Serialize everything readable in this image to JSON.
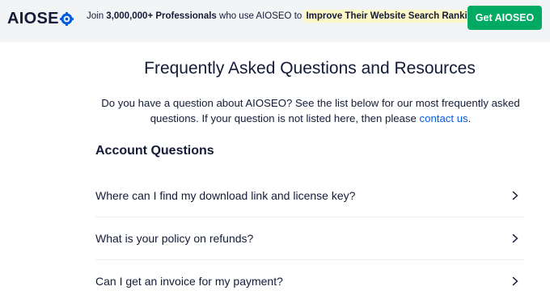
{
  "brand": {
    "logo_prefix": "AIOSE",
    "logo_suffix": "",
    "logo_full": "AIOSEO"
  },
  "promo": {
    "part1": "Join ",
    "count": "3,000,000+",
    "part2": " Professionals",
    "part3": " who use AIOSEO to ",
    "highlight": "Improve Their Website Search Rankings!"
  },
  "cta": {
    "label": "Get AIOSEO"
  },
  "faq": {
    "title": "Frequently Asked Questions and Resources",
    "intro_text": "Do you have a question about AIOSEO? See the list below for our most frequently asked questions. If your question is not listed here, then please ",
    "intro_link": "contact us",
    "intro_end": ".",
    "section_title": "Account Questions",
    "questions": [
      "Where can I find my download link and license key?",
      "What is your policy on refunds?",
      "Can I get an invoice for my payment?"
    ]
  },
  "colors": {
    "primary_green": "#00aa63",
    "brand_blue": "#005ae0",
    "highlight": "#fcf7c6",
    "text": "#141b38"
  }
}
